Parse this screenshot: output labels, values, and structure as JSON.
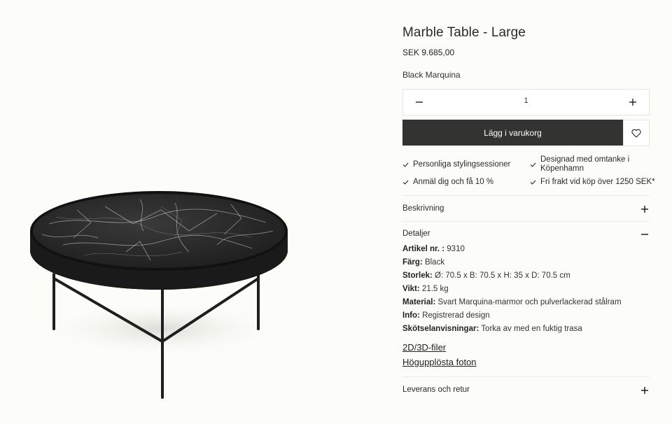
{
  "product": {
    "title": "Marble Table - Large",
    "price": "SEK 9.685,00",
    "variant": "Black Marquina"
  },
  "quantity": {
    "value": "1",
    "minus_icon": "minus-icon",
    "plus_icon": "plus-icon"
  },
  "cart": {
    "add_label": "Lägg i varukorg",
    "wishlist_icon": "heart-icon"
  },
  "usps": [
    {
      "text": "Personliga stylingsessioner"
    },
    {
      "text": "Designad med omtanke i Köpenhamn",
      "line1": "Designad med omtanke i",
      "line2": "Köpenhamn"
    },
    {
      "text": "Anmäl dig och få 10 %"
    },
    {
      "text": "Fri frakt vid köp över 1250 SEK*"
    }
  ],
  "accordion": {
    "description_label": "Beskrivning",
    "details_label": "Detaljer",
    "delivery_label": "Leverans och retur"
  },
  "details": [
    {
      "label": "Artikel nr. :",
      "value": "9310"
    },
    {
      "label": "Färg:",
      "value": "Black"
    },
    {
      "label": "Storlek:",
      "value": "Ø: 70.5 x B: 70.5 x H: 35 x D: 70.5 cm"
    },
    {
      "label": "Vikt:",
      "value": "21.5 kg"
    },
    {
      "label": "Material:",
      "value": "Svart Marquina-marmor och pulverlackerad stålram"
    },
    {
      "label": "Info:",
      "value": "Registrerad design"
    },
    {
      "label": "Skötselanvisningar:",
      "value": "Torka av med en fuktig trasa"
    }
  ],
  "downloads": {
    "files_label": "2D/3D-filer",
    "photos_label": "Högupplösta foton"
  },
  "colors": {
    "background": "#fcfcf8",
    "button": "#333331",
    "marble": "#232323"
  }
}
